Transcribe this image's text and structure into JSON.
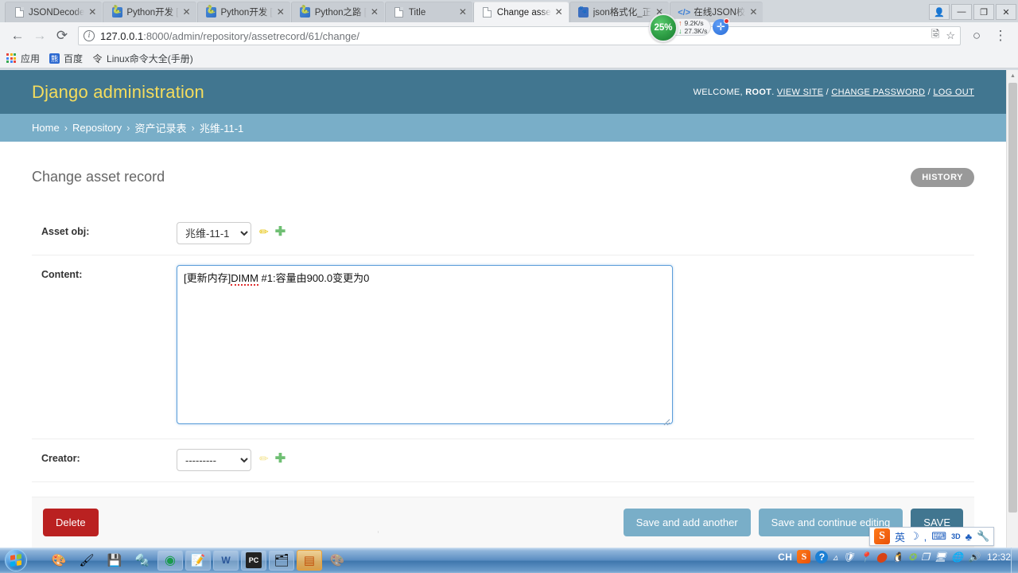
{
  "browser": {
    "tabs": [
      {
        "title": "JSONDecode",
        "icon": "page-icon",
        "active": false
      },
      {
        "title": "Python开发 [",
        "icon": "python-icon",
        "active": false
      },
      {
        "title": "Python开发 [",
        "icon": "python-icon",
        "active": false
      },
      {
        "title": "Python之路 [",
        "icon": "python-icon",
        "active": false
      },
      {
        "title": "Title",
        "icon": "page-icon",
        "active": false
      },
      {
        "title": "Change asse",
        "icon": "page-icon",
        "active": true
      },
      {
        "title": "json格式化_正",
        "icon": "json-format-icon",
        "active": false
      },
      {
        "title": "在线JSON校",
        "icon": "json-validator-icon",
        "active": false
      }
    ],
    "window_controls": {
      "minimize": "—",
      "maximize": "❐",
      "close": "✕",
      "user": "👤"
    },
    "nav": {
      "back": "←",
      "forward": "→",
      "reload": "⟳",
      "info_icon": "ⓘ",
      "url_host": "127.0.0.1",
      "url_path": ":8000/admin/repository/assetrecord/61/change/",
      "translate_icon": "translate-icon",
      "star_icon": "☆",
      "profile_icon": "○",
      "menu_icon": "⋮"
    },
    "netspeed": {
      "percent": "25%",
      "up": "9.2K/s",
      "down": "27.3K/s",
      "up_arrow": "↑",
      "down_arrow": "↓",
      "extension_glyph": "✛"
    },
    "bookmarks": [
      {
        "label": "应用",
        "icon": "apps-grid-icon"
      },
      {
        "label": "百度",
        "icon": "baidu-icon"
      },
      {
        "label": "Linux命令大全(手册)",
        "icon": "link-icon"
      }
    ]
  },
  "django": {
    "brand": "Django administration",
    "welcome_prefix": "WELCOME,",
    "username": "ROOT",
    "welcome_sep": ".",
    "links": {
      "view_site": "VIEW SITE",
      "change_password": "CHANGE PASSWORD",
      "log_out": "LOG OUT",
      "slash": "/"
    },
    "breadcrumbs": [
      {
        "label": "Home",
        "link": true
      },
      {
        "label": "Repository",
        "link": true
      },
      {
        "label": "资产记录表",
        "link": true
      },
      {
        "label": "兆维-11-1",
        "link": false
      }
    ],
    "breadcrumb_separator": "›",
    "page_title": "Change asset record",
    "history_button": "HISTORY",
    "fields": [
      {
        "name": "asset-obj",
        "label": "Asset obj:",
        "type": "select",
        "value": "兆维-11-1",
        "options": [
          "兆维-11-1"
        ],
        "edit_icon": "pencil-icon",
        "add_icon": "plus-icon",
        "edit_enabled": true
      },
      {
        "name": "content",
        "label": "Content:",
        "type": "textarea",
        "value": "[更新内存]DIMM #1:容量由900.0变更为0",
        "misspelled_word": "DIMM"
      },
      {
        "name": "creator",
        "label": "Creator:",
        "type": "select",
        "value": "---------",
        "options": [
          "---------"
        ],
        "edit_icon": "pencil-icon",
        "add_icon": "plus-icon",
        "edit_enabled": false
      }
    ],
    "buttons": {
      "delete": "Delete",
      "save_add_another": "Save and add another",
      "save_continue": "Save and continue editing",
      "save": "SAVE"
    },
    "colors": {
      "header": "#417690",
      "breadcrumb": "#79aec8",
      "brand_text": "#f5dd5d",
      "delete": "#ba2121",
      "save": "#417690",
      "light_button": "#79aec8",
      "history": "#999999"
    }
  },
  "ime": {
    "logo": "S",
    "mode": "英",
    "icons": [
      "moon-icon",
      "comma-icon",
      "keyboard-icon",
      "3d-icon",
      "skin-icon",
      "wrench-icon"
    ],
    "glyphs": {
      "moon": "🌙",
      "comma": "，",
      "keyboard": "⌨",
      "threed": "3D",
      "skin": "👕",
      "wrench": "🔧"
    }
  },
  "taskbar": {
    "start": "start-orb",
    "items": [
      {
        "name": "paint-palette-app",
        "glyph": "🎨",
        "state": "plain"
      },
      {
        "name": "color-tool-app",
        "glyph": "🖌",
        "state": "plain"
      },
      {
        "name": "save-disk-app",
        "glyph": "💾",
        "state": "plain"
      },
      {
        "name": "tool-app",
        "glyph": "🔩",
        "state": "plain"
      },
      {
        "name": "chrome-app",
        "glyph": "◉",
        "state": "framed"
      },
      {
        "name": "notepad-app",
        "glyph": "📝",
        "state": "framed"
      },
      {
        "name": "word-app",
        "glyph": "W",
        "state": "framed"
      },
      {
        "name": "pycharm-app",
        "glyph": "PC",
        "state": "framed"
      },
      {
        "name": "explorer-app",
        "glyph": "🗂",
        "state": "framed"
      },
      {
        "name": "active-window-app",
        "glyph": "▤",
        "state": "active"
      },
      {
        "name": "secondary-app",
        "glyph": "🎨",
        "state": "dimmed"
      }
    ],
    "tray": {
      "input_indicator": "CH",
      "sogou": "S",
      "help": "?",
      "overflow": "▵",
      "icons": [
        "shield-icon",
        "pin-icon",
        "record-icon",
        "qq-icon",
        "update-icon",
        "window-icon",
        "monitor-icon",
        "net-icon"
      ],
      "glyphs": {
        "shield": "🛡",
        "pin": "📍",
        "record": "⬤",
        "qq": "🐧",
        "update": "✪",
        "window": "❐",
        "monitor": "🖥",
        "net": "🌐",
        "volume": "🔊"
      },
      "clock": "12:32"
    }
  }
}
